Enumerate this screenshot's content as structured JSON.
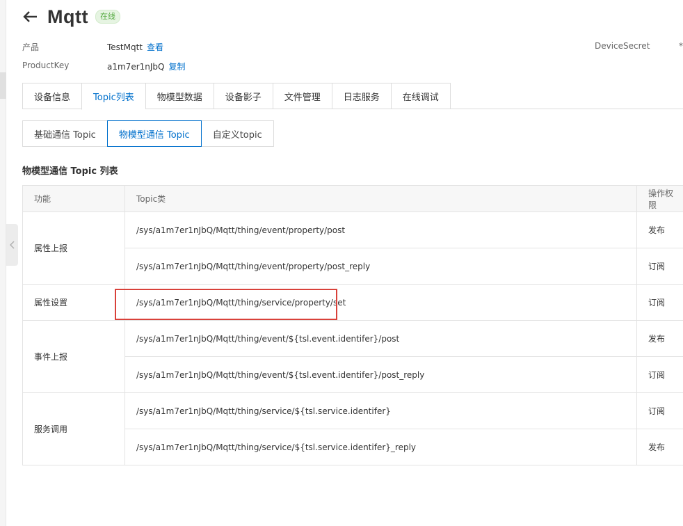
{
  "header": {
    "title": "Mqtt",
    "status": "在线"
  },
  "info": {
    "product_label": "产品",
    "product_value": "TestMqtt",
    "product_link": "查看",
    "productkey_label": "ProductKey",
    "productkey_value": "a1m7er1nJbQ",
    "productkey_link": "复制",
    "devicesecret_label": "DeviceSecret",
    "devicesecret_value": "*"
  },
  "main_tabs": [
    {
      "label": "设备信息",
      "active": false
    },
    {
      "label": "Topic列表",
      "active": true
    },
    {
      "label": "物模型数据",
      "active": false
    },
    {
      "label": "设备影子",
      "active": false
    },
    {
      "label": "文件管理",
      "active": false
    },
    {
      "label": "日志服务",
      "active": false
    },
    {
      "label": "在线调试",
      "active": false
    }
  ],
  "sub_tabs": [
    {
      "label": "基础通信 Topic",
      "active": false
    },
    {
      "label": "物模型通信 Topic",
      "active": true
    },
    {
      "label": "自定义topic",
      "active": false
    }
  ],
  "section_title": "物模型通信 Topic 列表",
  "table": {
    "headers": [
      "功能",
      "Topic类",
      "操作权限"
    ],
    "groups": [
      {
        "function": "属性上报",
        "rows": [
          {
            "topic": "/sys/a1m7er1nJbQ/Mqtt/thing/event/property/post",
            "permission": "发布"
          },
          {
            "topic": "/sys/a1m7er1nJbQ/Mqtt/thing/event/property/post_reply",
            "permission": "订阅"
          }
        ]
      },
      {
        "function": "属性设置",
        "rows": [
          {
            "topic": "/sys/a1m7er1nJbQ/Mqtt/thing/service/property/set",
            "permission": "订阅",
            "highlighted": true
          }
        ]
      },
      {
        "function": "事件上报",
        "rows": [
          {
            "topic": "/sys/a1m7er1nJbQ/Mqtt/thing/event/${tsl.event.identifer}/post",
            "permission": "发布"
          },
          {
            "topic": "/sys/a1m7er1nJbQ/Mqtt/thing/event/${tsl.event.identifer}/post_reply",
            "permission": "订阅"
          }
        ]
      },
      {
        "function": "服务调用",
        "rows": [
          {
            "topic": "/sys/a1m7er1nJbQ/Mqtt/thing/service/${tsl.service.identifer}",
            "permission": "订阅"
          },
          {
            "topic": "/sys/a1m7er1nJbQ/Mqtt/thing/service/${tsl.service.identifer}_reply",
            "permission": "发布"
          }
        ]
      }
    ]
  },
  "colors": {
    "accent": "#0070cc",
    "status_green": "#52a83e",
    "highlight_red": "#d9413a"
  },
  "icons": {
    "back": "arrow-left-icon",
    "collapse": "chevron-left-icon"
  }
}
